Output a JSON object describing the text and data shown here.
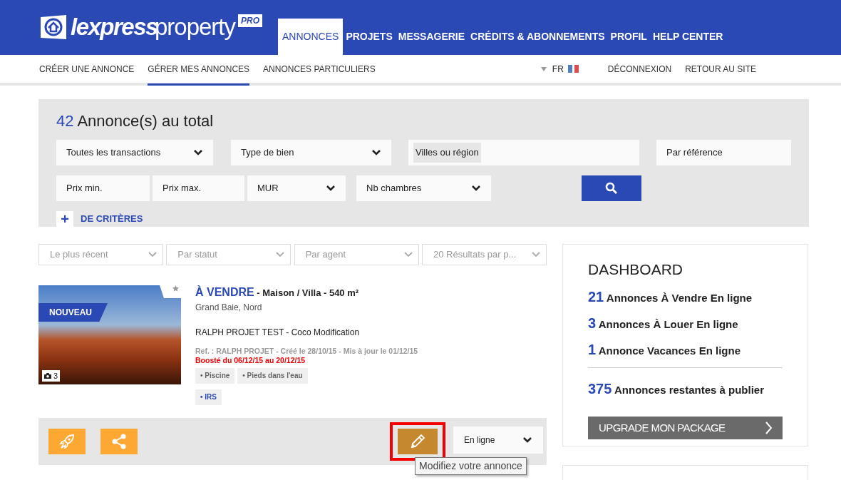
{
  "logo": {
    "bold": "lexpress",
    "light": "property",
    "badge": "PRO"
  },
  "main_nav": [
    {
      "label": "ANNONCES",
      "selected": true
    },
    {
      "label": "PROJETS",
      "selected": false
    },
    {
      "label": "MESSAGERIE",
      "selected": false
    },
    {
      "label": "CRÉDITS & ABONNEMENTS",
      "selected": false
    },
    {
      "label": "PROFIL",
      "selected": false
    },
    {
      "label": "HELP CENTER",
      "selected": false
    }
  ],
  "sub_nav": [
    {
      "label": "CRÉER UNE ANNONCE",
      "selected": false
    },
    {
      "label": "GÉRER MES ANNONCES",
      "selected": true
    },
    {
      "label": "ANNONCES PARTICULIERS",
      "selected": false
    }
  ],
  "language": "FR",
  "account_links": [
    "DÉCONNEXION",
    "RETOUR AU SITE"
  ],
  "search": {
    "count": "42",
    "count_label": "Annonce(s) au total",
    "row_1": [
      {
        "kind": "select",
        "label": "Toutes les transactions"
      },
      {
        "kind": "select",
        "label": "Type de bien"
      },
      {
        "kind": "chip",
        "label": "Villes ou région"
      },
      {
        "kind": "input",
        "label": "Par référence"
      }
    ],
    "row_2": [
      {
        "kind": "input",
        "label": "Prix min."
      },
      {
        "kind": "input",
        "label": "Prix max."
      },
      {
        "kind": "select",
        "label": "MUR"
      },
      {
        "kind": "select",
        "label": "Nb chambres"
      }
    ],
    "more_criteria": {
      "icon": "+",
      "label": "DE CRITÈRES"
    }
  },
  "sort_filters": [
    "Le plus récent",
    "Par statut",
    "Par agent",
    "20 Résultats par p..."
  ],
  "listing": {
    "badge": "NOUVEAU",
    "photo_count": "3",
    "transaction": "À VENDRE",
    "details": " - Maison / Villa - 540 m²",
    "location": "Grand Baie, Nord",
    "title": "RALPH PROJET TEST - Coco Modification",
    "meta": "Ref. : RALPH PROJET - Créé le 28/10/15 - Mis à jour le 01/12/15",
    "boost": "Boosté du 06/12/15 au 20/12/15",
    "tags": [
      {
        "label": "• Piscine",
        "kind": "feature"
      },
      {
        "label": "• Pieds dans l'eau",
        "kind": "feature"
      },
      {
        "label": "• IRS",
        "kind": "scheme"
      }
    ],
    "edit_highlighted": true,
    "status": "En ligne",
    "tooltip": "Modifiez votre annonce"
  },
  "dashboard": {
    "title": "DASHBOARD",
    "stats": [
      {
        "count": "21",
        "label": "Annonces À Vendre En ligne"
      },
      {
        "count": "3",
        "label": "Annonces À Louer En ligne"
      },
      {
        "count": "1",
        "label": "Annonce Vacances En ligne"
      }
    ],
    "remaining": {
      "count": "375",
      "label": "Annonces restantes à publier"
    },
    "upgrade": "UPGRADE MON PACKAGE"
  }
}
